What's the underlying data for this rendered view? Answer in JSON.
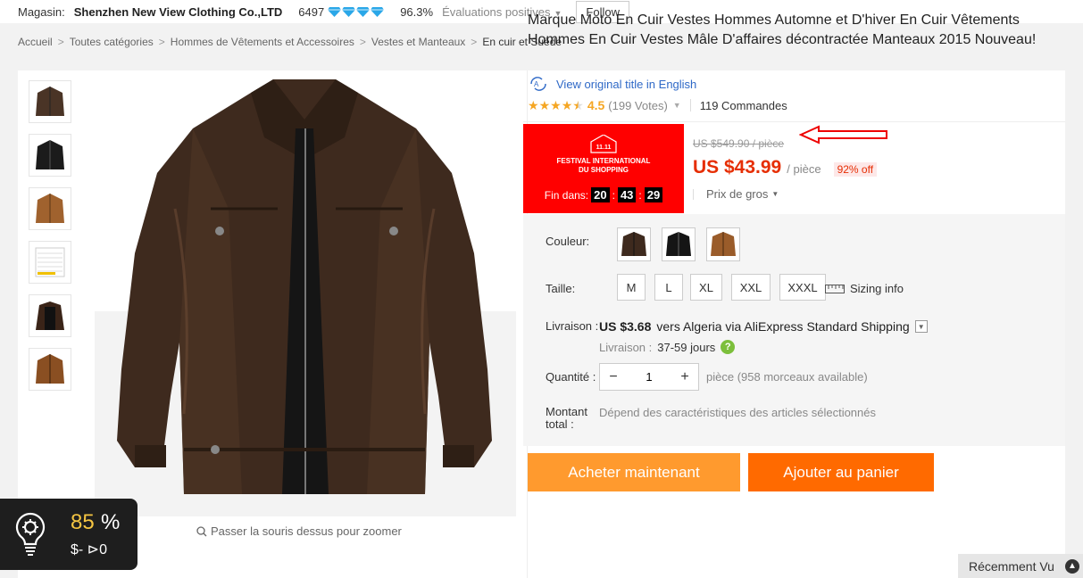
{
  "store": {
    "label": "Magasin:",
    "name": "Shenzhen New View Clothing Co.,LTD",
    "score": "6497",
    "positive_pct": "96.3%",
    "positive_label": "Évaluations positives",
    "follow_label": "Follow"
  },
  "breadcrumb": [
    "Accueil",
    "Toutes catégories",
    "Hommes de Vêtements et Accessoires",
    "Vestes et Manteaux",
    "En cuir et Suède"
  ],
  "gallery": {
    "zoom_hint": "Passer la souris dessus pour zoomer"
  },
  "product": {
    "title": "Marque Moto En Cuir Vestes Hommes Automne et D'hiver En Cuir Vêtements Hommes En Cuir Vestes Mâle D'affaires décontractée Manteaux 2015 Nouveau!",
    "original_title_link": "View original title in English",
    "rating": "4.5",
    "votes": "(199 Votes)",
    "orders": "119 Commandes",
    "rating_fraction": 0.9
  },
  "festival": {
    "logo": "11.11",
    "name_line1": "FESTIVAL INTERNATIONAL",
    "name_line2": "DU SHOPPING",
    "ends_label": "Fin dans:",
    "hours": "20",
    "minutes": "43",
    "seconds": "29"
  },
  "price": {
    "old": "US $549.90 / pièce",
    "current": "US $43.99",
    "unit": "/ pièce",
    "discount": "92% off",
    "bulk_label": "Prix de gros"
  },
  "options": {
    "color_label": "Couleur:",
    "size_label": "Taille:",
    "sizes": [
      "M",
      "L",
      "XL",
      "XXL",
      "XXXL"
    ],
    "sizing_info": "Sizing info",
    "shipping_label": "Livraison :",
    "shipping_price": "US $3.68",
    "shipping_rest": "vers Algeria via AliExpress Standard Shipping",
    "delivery_label": "Livraison :",
    "delivery_days": "37-59 jours",
    "qty_label": "Quantité :",
    "qty_value": "1",
    "qty_available": "pièce (958 morceaux available)",
    "total_label_1": "Montant",
    "total_label_2": "total :",
    "total_note": "Dépend des caractéristiques des articles sélectionnés"
  },
  "actions": {
    "buy": "Acheter maintenant",
    "cart": "Ajouter au panier"
  },
  "widget": {
    "percent": "85",
    "percent_sign": "%",
    "stats": "$-  ⊳0"
  },
  "recent": {
    "label": "Récemment Vu"
  },
  "colors": {
    "price_red": "#e62e04",
    "festival_red": "#ff0000",
    "buy_orange": "#ff9a2e",
    "cart_orange": "#ff6a00",
    "link_blue": "#2f69c7",
    "star": "#f5a623"
  }
}
